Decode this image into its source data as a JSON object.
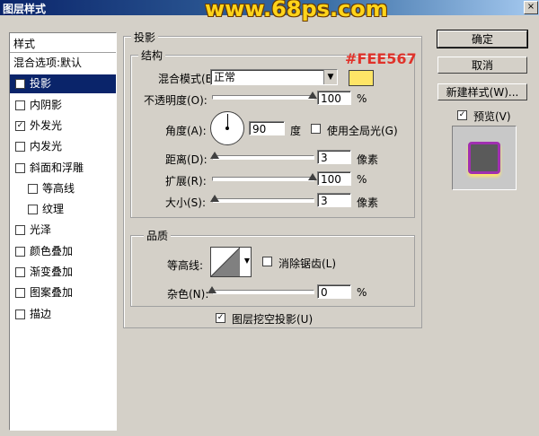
{
  "window": {
    "title": "图层样式",
    "site": "www.68ps.com",
    "close": "×"
  },
  "styles": {
    "header": "样式",
    "items": [
      {
        "label": "混合选项:默认",
        "checked": null,
        "selected": false
      },
      {
        "label": "投影",
        "checked": true,
        "selected": true
      },
      {
        "label": "内阴影",
        "checked": false,
        "selected": false
      },
      {
        "label": "外发光",
        "checked": true,
        "selected": false
      },
      {
        "label": "内发光",
        "checked": false,
        "selected": false
      },
      {
        "label": "斜面和浮雕",
        "checked": false,
        "selected": false
      },
      {
        "label": "等高线",
        "checked": false,
        "selected": false
      },
      {
        "label": "纹理",
        "checked": false,
        "selected": false
      },
      {
        "label": "光泽",
        "checked": false,
        "selected": false
      },
      {
        "label": "颜色叠加",
        "checked": false,
        "selected": false
      },
      {
        "label": "渐变叠加",
        "checked": false,
        "selected": false
      },
      {
        "label": "图案叠加",
        "checked": false,
        "selected": false
      },
      {
        "label": "描边",
        "checked": false,
        "selected": false
      }
    ]
  },
  "shadow": {
    "group_title": "投影",
    "structure_title": "结构",
    "annotation": "#FEE567",
    "annotation_color": "#FEE567",
    "swatch_color": "#fee567",
    "blend_label": "混合模式(B):",
    "blend_value": "正常",
    "opacity_label": "不透明度(O):",
    "opacity": "100",
    "opacity_unit": "%",
    "angle_label": "角度(A):",
    "angle": "90",
    "angle_unit": "度",
    "global_light": "使用全局光(G)",
    "distance_label": "距离(D):",
    "distance": "3",
    "distance_unit": "像素",
    "spread_label": "扩展(R):",
    "spread": "100",
    "spread_unit": "%",
    "size_label": "大小(S):",
    "size": "3",
    "size_unit": "像素",
    "quality_title": "品质",
    "contour_label": "等高线:",
    "antialias": "消除锯齿(L)",
    "noise_label": "杂色(N):",
    "noise": "0",
    "noise_unit": "%",
    "knockout": "图层挖空投影(U)",
    "levels": {
      "opacity": 1.0,
      "distance": 0.03,
      "spread": 1.0,
      "size": 0.03,
      "noise": 0.0
    }
  },
  "buttons": {
    "ok": "确定",
    "cancel": "取消",
    "new_style": "新建样式(W)...",
    "preview": "预览(V)"
  }
}
